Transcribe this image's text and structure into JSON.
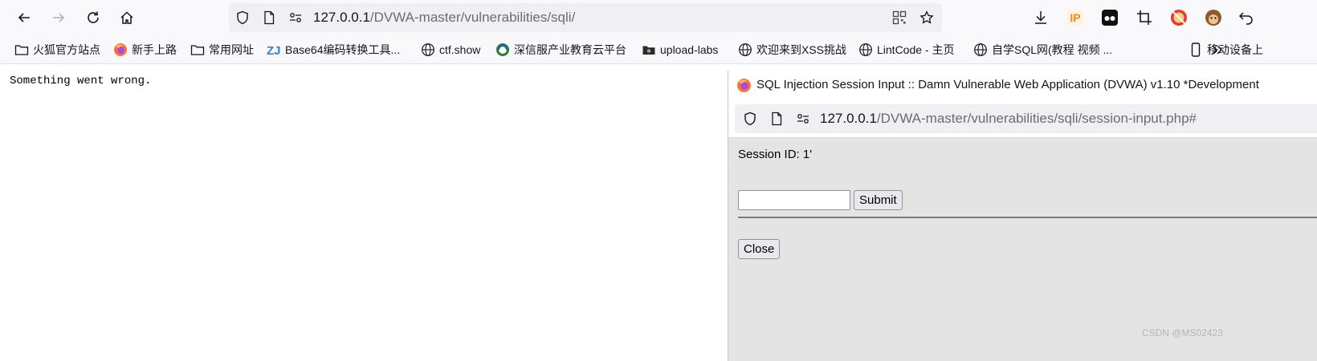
{
  "browser": {
    "url_host": "127.0.0.1",
    "url_path": "/DVWA-master/vulnerabilities/sqli/"
  },
  "bookmarks": [
    {
      "label": "火狐官方站点",
      "icon": "folder-icon"
    },
    {
      "label": "新手上路",
      "icon": "firefox-icon"
    },
    {
      "label": "常用网址",
      "icon": "folder-icon"
    },
    {
      "label": "Base64编码转换工具...",
      "icon": "zj-icon"
    },
    {
      "label": "ctf.show",
      "icon": "globe-icon"
    },
    {
      "label": "深信服产业教育云平台",
      "icon": "sangfor-icon"
    },
    {
      "label": "upload-labs",
      "icon": "folder-dark-icon"
    },
    {
      "label": "欢迎来到XSS挑战",
      "icon": "globe-icon"
    },
    {
      "label": "LintCode - 主页",
      "icon": "globe-icon"
    },
    {
      "label": "自学SQL网(教程 视频 ...",
      "icon": "globe-icon"
    },
    {
      "label": "移动设备上",
      "icon": "mobile-icon"
    }
  ],
  "page": {
    "message": "Something went wrong."
  },
  "popup": {
    "title": "SQL Injection Session Input :: Damn Vulnerable Web Application (DVWA) v1.10 *Development",
    "url_host": "127.0.0.1",
    "url_path": "/DVWA-master/vulnerabilities/sqli/session-input.php#",
    "session_label": "Session ID: 1'",
    "input_value": "",
    "submit_label": "Submit",
    "close_label": "Close"
  },
  "watermark": "CSDN @MS02423",
  "colors": {
    "toolbar_bg": "#f9f9fb",
    "urlbar_bg": "#f0f0f4",
    "popup_bg": "#e4e4e4",
    "ip_icon": "#f28c18"
  }
}
